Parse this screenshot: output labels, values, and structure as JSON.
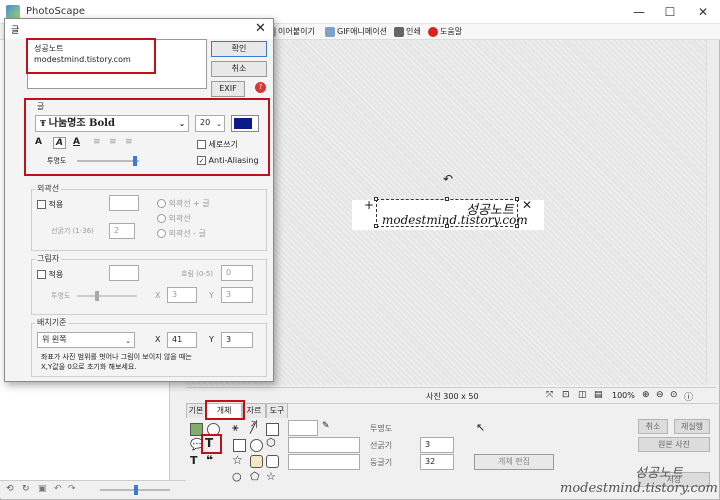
{
  "window": {
    "title": "PhotoScape",
    "minimize": "—",
    "maximize": "☐",
    "close": "✕"
  },
  "toolbar": {
    "items": [
      "이어붙이기",
      "GIF애니메이션",
      "인쇄",
      "도움말"
    ]
  },
  "canvas": {
    "object_line1": "성공노트",
    "object_line2": "modestmind.tistory.com"
  },
  "status": {
    "size": "사진 300 x 50",
    "zoom": "100%"
  },
  "dialog": {
    "title": "글",
    "text_value": "성공노트\nmodestmind.tistory.com",
    "ok_label": "확인",
    "cancel_label": "취소",
    "exif_label": "EXIF",
    "font_group_label": "글",
    "font_name": "나눔명조 Bold",
    "font_size": "20",
    "font_color": "#0a1a8a",
    "style_buttons": [
      "A",
      "A",
      "A",
      "≡",
      "≡",
      "≡"
    ],
    "vertical_label": "세로쓰기",
    "antialias_label": "Anti-Aliasing",
    "opacity_label": "투명도",
    "outline_group_label": "외곽선",
    "outline_apply": "적용",
    "outline_thickness_label": "선굵기 (1-36)",
    "outline_thickness": "2",
    "outline_opts": [
      "외곽선 + 글",
      "외곽선",
      "외곽선 - 글"
    ],
    "shadow_group_label": "그림자",
    "shadow_apply": "적용",
    "shadow_blur_label": "흐림 (0-5)",
    "shadow_blur": "0",
    "shadow_opacity_label": "투명도",
    "shadow_x_label": "X",
    "shadow_x": "3",
    "shadow_y_label": "Y",
    "shadow_y": "3",
    "pos_group_label": "배치기준",
    "pos_value": "위 왼쪽",
    "pos_x_label": "X",
    "pos_x": "41",
    "pos_y_label": "Y",
    "pos_y": "3",
    "pos_note": "좌표가 사진 범위를 벗어나 그림이 보이지 않을 때는\nX,Y값을 0으로 초기화 해보세요."
  },
  "bottom": {
    "tabs": [
      "기본",
      "개체",
      "자르기",
      "도구"
    ],
    "opacity_label": "투명도",
    "thickness_label": "선굵기",
    "thickness": "3",
    "roundness_label": "둥글기",
    "roundness": "32",
    "object_edit_label": "개체 편집",
    "undo_label": "취소",
    "redo_label": "재실행",
    "original_label": "원본 사진",
    "save_label": "저장"
  },
  "watermark": {
    "line1": "성공노트",
    "line2": "modestmind.tistory.com"
  },
  "colors": {
    "accent_red": "#c0111a",
    "swatch": "#0a1a8a"
  }
}
